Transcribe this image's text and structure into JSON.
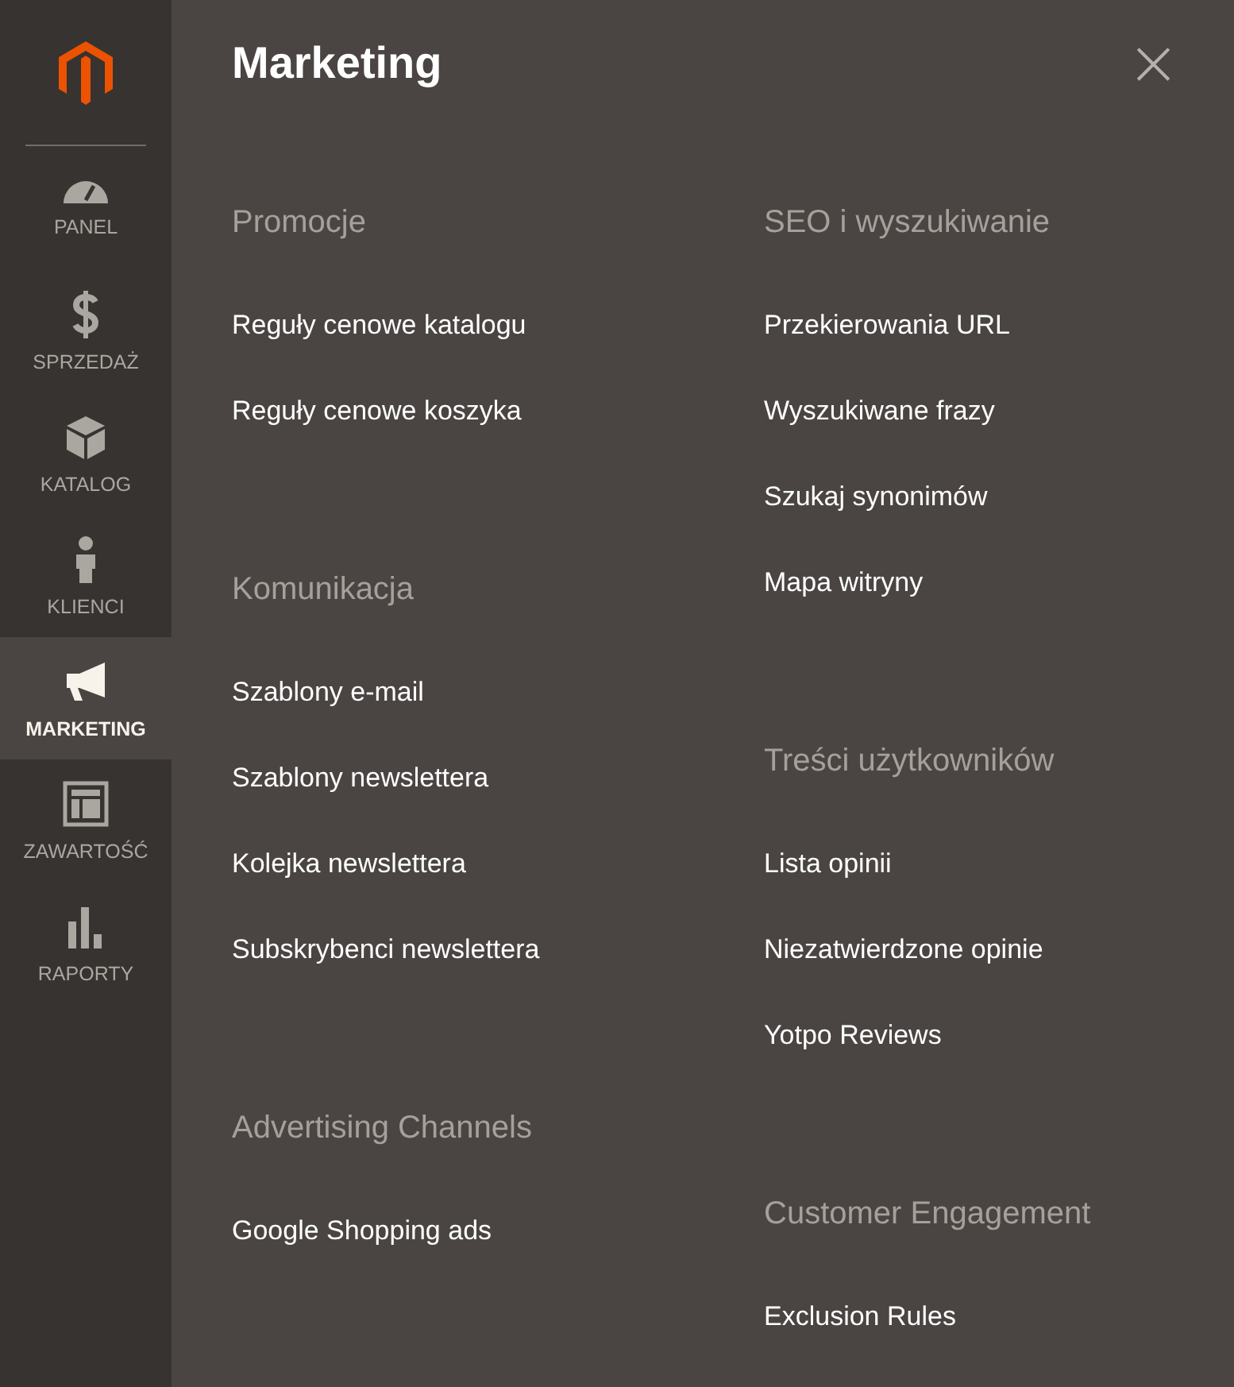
{
  "sidebar": {
    "items": [
      {
        "kind": "dashboard",
        "label": "PANEL",
        "selected": false
      },
      {
        "kind": "sales",
        "label": "SPRZEDAŻ",
        "selected": false
      },
      {
        "kind": "catalog",
        "label": "KATALOG",
        "selected": false
      },
      {
        "kind": "customers",
        "label": "KLIENCI",
        "selected": false
      },
      {
        "kind": "marketing",
        "label": "MARKETING",
        "selected": true
      },
      {
        "kind": "content",
        "label": "ZAWARTOŚĆ",
        "selected": false
      },
      {
        "kind": "reports",
        "label": "RAPORTY",
        "selected": false
      }
    ]
  },
  "panel": {
    "title": "Marketing",
    "close": "×",
    "columns": [
      [
        {
          "heading": "Promocje",
          "links": [
            "Reguły cenowe katalogu",
            "Reguły cenowe koszyka"
          ]
        },
        {
          "heading": "Komunikacja",
          "links": [
            "Szablony e-mail",
            "Szablony newslettera",
            "Kolejka newslettera",
            "Subskrybenci newslettera"
          ]
        },
        {
          "heading": "Advertising Channels",
          "links": [
            "Google Shopping ads"
          ]
        }
      ],
      [
        {
          "heading": "SEO i wyszukiwanie",
          "links": [
            "Przekierowania URL",
            "Wyszukiwane frazy",
            "Szukaj synonimów",
            "Mapa witryny"
          ]
        },
        {
          "heading": "Treści użytkowników",
          "links": [
            "Lista opinii",
            "Niezatwierdzone opinie",
            "Yotpo Reviews"
          ]
        },
        {
          "heading": "Customer Engagement",
          "links": [
            "Exclusion Rules"
          ]
        }
      ]
    ]
  }
}
